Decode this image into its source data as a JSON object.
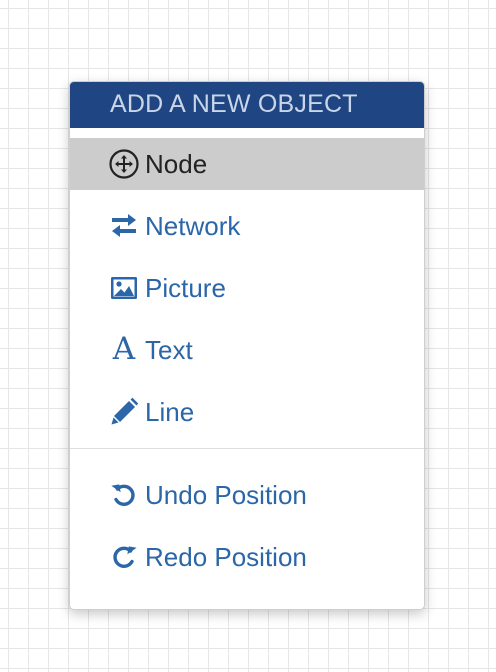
{
  "menu": {
    "header": "ADD A NEW OBJECT",
    "items": [
      {
        "label": "Node",
        "icon": "move-arrows-circle-icon",
        "active": true
      },
      {
        "label": "Network",
        "icon": "swap-arrows-icon"
      },
      {
        "label": "Picture",
        "icon": "image-icon"
      },
      {
        "label": "Text",
        "icon": "font-serif-a-icon",
        "glyph": "A"
      },
      {
        "label": "Line",
        "icon": "pencil-icon"
      }
    ],
    "actions": [
      {
        "label": "Undo Position",
        "icon": "undo-icon"
      },
      {
        "label": "Redo Position",
        "icon": "redo-icon"
      }
    ]
  },
  "colors": {
    "header_bg": "#1f4682",
    "header_text": "#c9d6ea",
    "link": "#2a66a8",
    "active_bg": "#cccccc"
  }
}
